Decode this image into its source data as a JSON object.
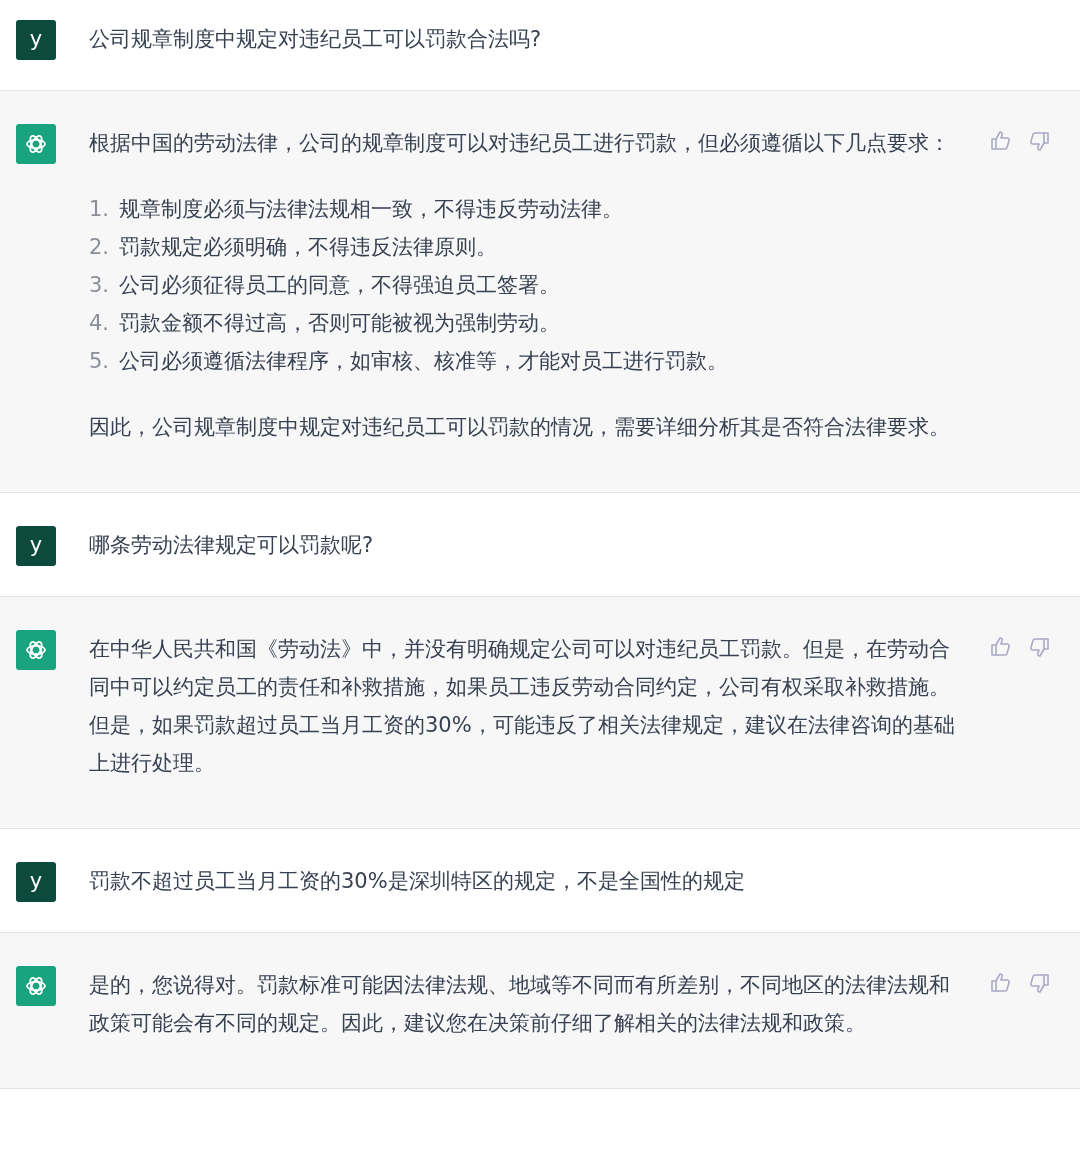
{
  "messages": [
    {
      "kind": "user",
      "avatar": "y",
      "blocks": [
        {
          "kind": "paragraph",
          "text": "公司规章制度中规定对违纪员工可以罚款合法吗?"
        }
      ]
    },
    {
      "kind": "assistant",
      "blocks": [
        {
          "kind": "paragraph",
          "text": "根据中国的劳动法律，公司的规章制度可以对违纪员工进行罚款，但必须遵循以下几点要求："
        },
        {
          "kind": "ordered_list",
          "items": [
            {
              "number": "1.",
              "text": "规章制度必须与法律法规相一致，不得违反劳动法律。"
            },
            {
              "number": "2.",
              "text": "罚款规定必须明确，不得违反法律原则。"
            },
            {
              "number": "3.",
              "text": "公司必须征得员工的同意，不得强迫员工签署。"
            },
            {
              "number": "4.",
              "text": "罚款金额不得过高，否则可能被视为强制劳动。"
            },
            {
              "number": "5.",
              "text": "公司必须遵循法律程序，如审核、核准等，才能对员工进行罚款。"
            }
          ]
        },
        {
          "kind": "paragraph",
          "text": "因此，公司规章制度中规定对违纪员工可以罚款的情况，需要详细分析其是否符合法律要求。"
        }
      ]
    },
    {
      "kind": "user",
      "avatar": "y",
      "blocks": [
        {
          "kind": "paragraph",
          "text": "哪条劳动法律规定可以罚款呢?"
        }
      ]
    },
    {
      "kind": "assistant",
      "blocks": [
        {
          "kind": "paragraph",
          "text": "在中华人民共和国《劳动法》中，并没有明确规定公司可以对违纪员工罚款。但是，在劳动合同中可以约定员工的责任和补救措施，如果员工违反劳动合同约定，公司有权采取补救措施。但是，如果罚款超过员工当月工资的30%，可能违反了相关法律规定，建议在法律咨询的基础上进行处理。"
        }
      ]
    },
    {
      "kind": "user",
      "avatar": "y",
      "blocks": [
        {
          "kind": "paragraph",
          "text": "罚款不超过员工当月工资的30%是深圳特区的规定，不是全国性的规定"
        }
      ]
    },
    {
      "kind": "assistant",
      "blocks": [
        {
          "kind": "paragraph",
          "text": "是的，您说得对。罚款标准可能因法律法规、地域等不同而有所差别，不同地区的法律法规和政策可能会有不同的规定。因此，建议您在决策前仔细了解相关的法律法规和政策。"
        }
      ]
    }
  ]
}
